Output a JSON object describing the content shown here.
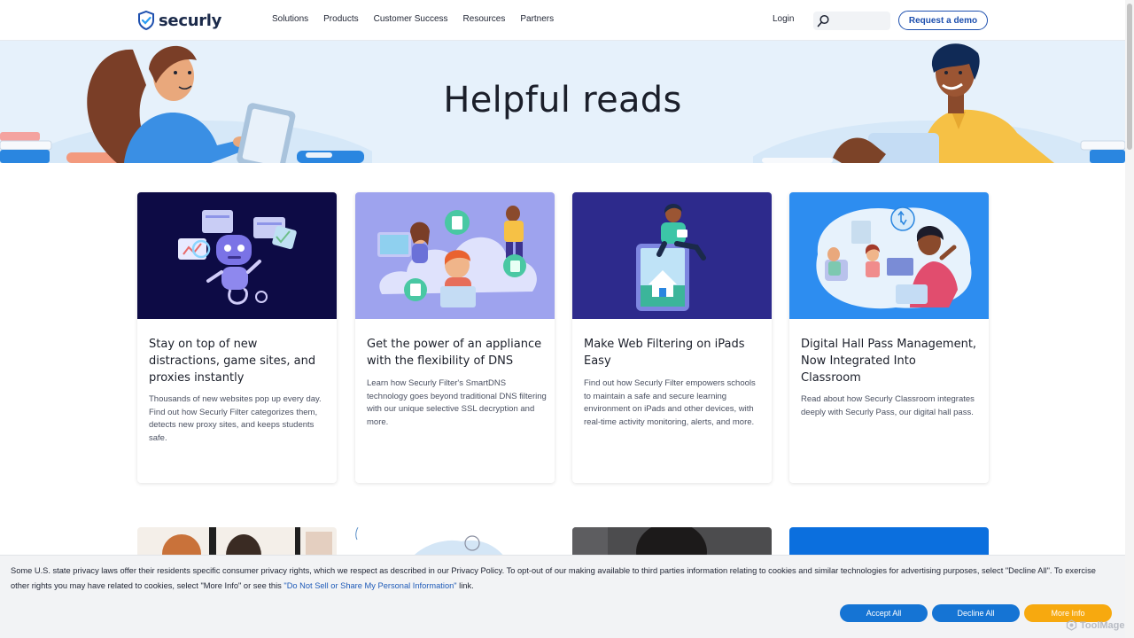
{
  "header": {
    "logo_text": "securly",
    "nav": [
      "Solutions",
      "Products",
      "Customer Success",
      "Resources",
      "Partners"
    ],
    "login": "Login",
    "search_value": "",
    "demo_button": "Request a demo"
  },
  "hero": {
    "title": "Helpful reads"
  },
  "cards": [
    {
      "title": "Stay on top of new distractions, game sites, and proxies instantly",
      "desc": "Thousands of new websites pop up every day. Find out how Securly Filter categorizes them, detects new proxy sites, and keeps students safe."
    },
    {
      "title": "Get the power of an appliance with the flexibility of DNS",
      "desc": "Learn how Securly Filter's SmartDNS technology goes beyond traditional DNS filtering with our unique selective SSL decryption and more."
    },
    {
      "title": "Make Web Filtering on iPads Easy",
      "desc": "Find out how Securly Filter empowers schools to maintain a safe and secure learning environment on iPads and other devices, with real-time activity monitoring, alerts, and more."
    },
    {
      "title": "Digital Hall Pass Management, Now Integrated Into Classroom",
      "desc": "Read about how Securly Classroom integrates deeply with Securly Pass, our digital hall pass."
    }
  ],
  "cookie": {
    "text_before": "Some U.S. state privacy laws offer their residents specific consumer privacy rights, which we respect as described in our Privacy Policy. To opt-out of our making available to third parties information relating to cookies and similar technologies for advertising purposes, select \"Decline All\". To exercise other rights you may have related to cookies, select \"More Info\" or see this ",
    "link": "\"Do Not Sell or Share My Personal Information\"",
    "text_after": " link.",
    "accept": "Accept All",
    "decline": "Decline All",
    "more": "More Info"
  },
  "watermark": "ToolMage",
  "colors": {
    "brand_blue": "#1d4fae",
    "button_blue": "#1574d4",
    "button_orange": "#f7a90f",
    "hero_bg": "#e6f1fb"
  }
}
